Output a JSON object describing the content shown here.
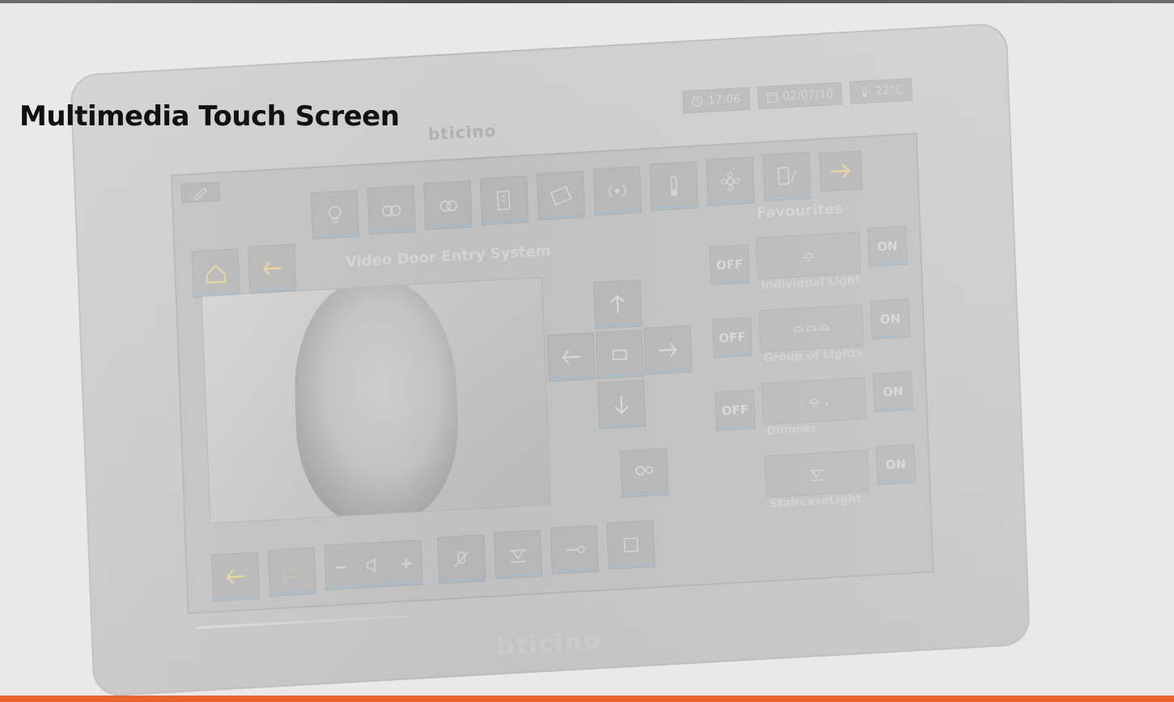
{
  "page": {
    "title": "Multimedia Touch Screen"
  },
  "device": {
    "brand": "bticino",
    "status": {
      "time": "17:06",
      "date": "02/07/10",
      "temperature": "22°C"
    },
    "screen_title": "Video Door Entry System",
    "favourites": {
      "title": "Favourites",
      "off_label": "OFF",
      "on_label": "ON",
      "items": [
        {
          "label": "Individual Light"
        },
        {
          "label": "Group of Lights"
        },
        {
          "label": "Dimmer"
        },
        {
          "label": "StaircaseLight"
        }
      ]
    },
    "volume": {
      "minus": "−",
      "plus": "+"
    }
  },
  "colors": {
    "accent_bottom": "#e8662d",
    "top_rule": "#2a2a2a",
    "title_text": "#111111"
  }
}
